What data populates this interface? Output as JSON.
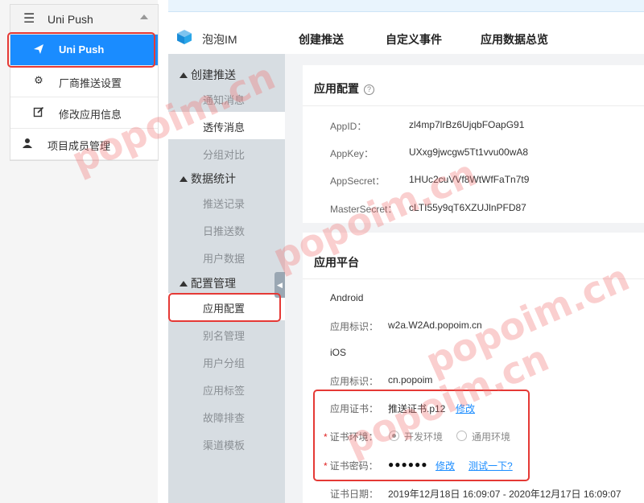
{
  "sidebar": {
    "header": "Uni Push",
    "items": [
      {
        "label": "Uni Push",
        "icon": "paper-plane-icon"
      },
      {
        "label": "厂商推送设置",
        "icon": "gear-icon"
      },
      {
        "label": "修改应用信息",
        "icon": "edit-icon"
      },
      {
        "label": "项目成员管理",
        "icon": "user-icon"
      }
    ]
  },
  "header": {
    "app_name": "泡泡IM",
    "tabs": [
      "创建推送",
      "自定义事件",
      "应用数据总览"
    ]
  },
  "subnav": {
    "groups": [
      {
        "title": "创建推送",
        "items": [
          "通知消息",
          "透传消息",
          "分组对比"
        ]
      },
      {
        "title": "数据统计",
        "items": [
          "推送记录",
          "日推送数",
          "用户数据"
        ]
      },
      {
        "title": "配置管理",
        "items": [
          "应用配置",
          "别名管理",
          "用户分组",
          "应用标签",
          "故障排查",
          "渠道模板"
        ]
      }
    ]
  },
  "app_config": {
    "title": "应用配置",
    "rows": [
      {
        "label": "AppID：",
        "value": "zl4mp7lrBz6UjqbFOapG91"
      },
      {
        "label": "AppKey：",
        "value": "UXxg9jwcgw5Tt1vvu00wA8"
      },
      {
        "label": "AppSecret：",
        "value": "1HUc2cuVVf8WtWfFaTn7t9"
      },
      {
        "label": "MasterSecret：",
        "value": "cLTI55y9qT6XZUJlnPFD87"
      }
    ]
  },
  "platform": {
    "title": "应用平台",
    "android": {
      "name": "Android",
      "id_label": "应用标识：",
      "id_value": "w2a.W2Ad.popoim.cn"
    },
    "ios": {
      "name": "iOS",
      "id_label": "应用标识：",
      "id_value": "cn.popoim",
      "cert_label": "应用证书：",
      "cert_value": "推送证书.p12",
      "cert_modify": "修改",
      "env_label": "证书环境：",
      "env_options": [
        "开发环境",
        "通用环境"
      ],
      "env_selected": "开发环境",
      "pwd_label": "证书密码：",
      "pwd_value": "●●●●●●",
      "pwd_modify": "修改",
      "pwd_test": "测试一下?",
      "date_label": "证书日期：",
      "date_value": "2019年12月18日 16:09:07 - 2020年12月17日 16:09:07"
    }
  },
  "watermark": "popoim.cn",
  "colors": {
    "accent": "#1a8cff",
    "highlight": "#e53935",
    "subnav_bg": "#d7dde2"
  }
}
